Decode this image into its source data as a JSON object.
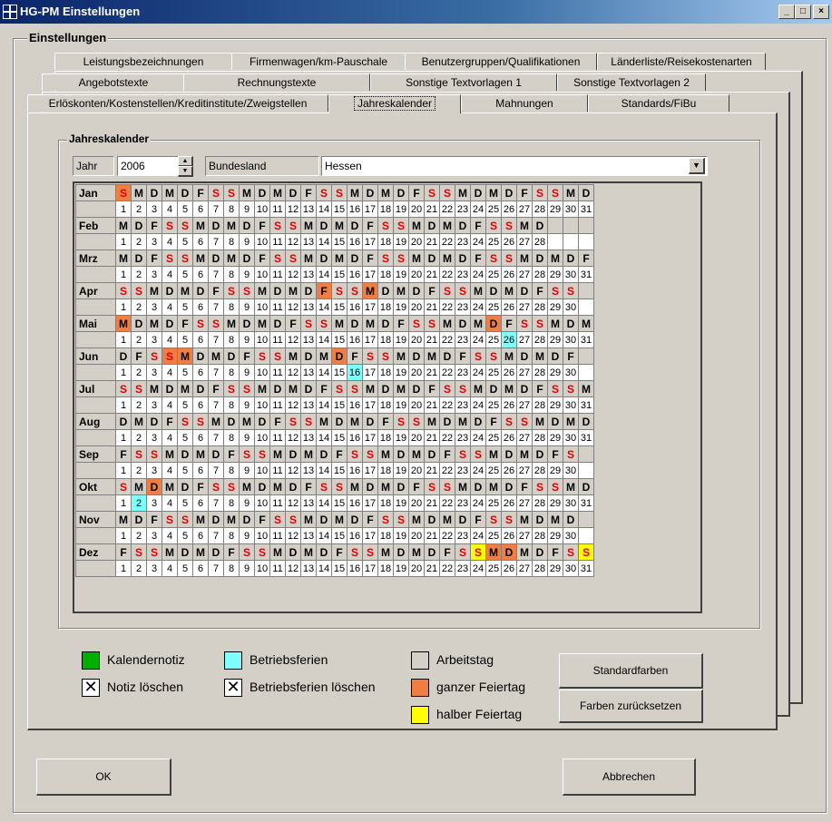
{
  "window": {
    "title": "HG-PM Einstellungen",
    "min": "_",
    "max": "□",
    "close": "×"
  },
  "outer_group": "Einstellungen",
  "tabs_row1": [
    "Leistungsbezeichnungen",
    "Firmenwagen/km-Pauschale",
    "Benutzergruppen/Qualifikationen",
    "Länderliste/Reisekostenarten"
  ],
  "tabs_row2": [
    "Angebotstexte",
    "Rechnungstexte",
    "Sonstige Textvorlagen 1",
    "Sonstige Textvorlagen 2"
  ],
  "tabs_row3": [
    "Erlöskonten/Kostenstellen/Kreditinstitute/Zweigstellen",
    "Jahreskalender",
    "Mahnungen",
    "Standards/FiBu"
  ],
  "cal_group": "Jahreskalender",
  "jahr_label": "Jahr",
  "jahr_value": "2006",
  "bundesland_label": "Bundesland",
  "bundesland_value": "Hessen",
  "months": [
    {
      "name": "Jan",
      "days": "SMDMDFSSMDMDFSSMDMDFSSMDMDFSSMD",
      "full": [
        1
      ],
      "half": [],
      "ferien": []
    },
    {
      "name": "Feb",
      "days": "MDFSSMDMDFSSMDMDFSSMDMDFSSMD",
      "full": [],
      "half": [],
      "ferien": []
    },
    {
      "name": "Mrz",
      "days": "MDFSSMDMDFSSMDMDFSSMDMDFSSMDMDF",
      "full": [],
      "half": [],
      "ferien": []
    },
    {
      "name": "Apr",
      "days": "SSMDMDFSSMDMDFSSMDMDFSSMDMDFSS",
      "full": [
        14,
        17
      ],
      "half": [],
      "ferien": []
    },
    {
      "name": "Mai",
      "days": "MDMDFSSMDMDFSSMDMDFSSMDMDFSSMDM",
      "full": [
        1,
        25
      ],
      "half": [],
      "ferien": [
        26
      ]
    },
    {
      "name": "Jun",
      "days": "DFSSMDMDFSSMDMDFSSMDMDFSSMDMDF",
      "full": [
        4,
        5,
        15
      ],
      "half": [],
      "ferien": [
        16
      ]
    },
    {
      "name": "Jul",
      "days": "SSMDMDFSSMDMDFSSMDMDFSSMDMDFSSM",
      "full": [],
      "half": [],
      "ferien": []
    },
    {
      "name": "Aug",
      "days": "DMDFSSMDMDFSSMDMDFSSMDMDFSSMDMD",
      "full": [],
      "half": [],
      "ferien": []
    },
    {
      "name": "Sep",
      "days": "FSSMDMDFSSMDMDFSSMDMDFSSMDMDFS",
      "full": [],
      "half": [],
      "ferien": []
    },
    {
      "name": "Okt",
      "days": "SMDMDFSSMDMDFSSMDMDFSSMDMDFSSMD",
      "full": [
        3
      ],
      "half": [],
      "ferien": [
        2
      ]
    },
    {
      "name": "Nov",
      "days": "MDFSSMDMDFSSMDMDFSSMDMDFSSMDMD",
      "full": [],
      "half": [],
      "ferien": []
    },
    {
      "name": "Dez",
      "days": "FSSMDMDFSSMDMDFSSMDMDFSSMDMDFSS",
      "full": [
        25,
        26
      ],
      "half": [
        24,
        31
      ],
      "ferien": []
    }
  ],
  "legend": {
    "kalendernotiz": "Kalendernotiz",
    "notiz_loeschen": "Notiz löschen",
    "betriebsferien": "Betriebsferien",
    "betriebsferien_loeschen": "Betriebsferien löschen",
    "arbeitstag": "Arbeitstag",
    "ganzer_feiertag": "ganzer Feiertag",
    "halber_feiertag": "halber Feiertag"
  },
  "buttons": {
    "standardfarben": "Standardfarben",
    "farben_zuruecksetzen": "Farben zurücksetzen",
    "ok": "OK",
    "abbrechen": "Abbrechen"
  },
  "colors": {
    "full": "#f07e43",
    "half": "#ffff00",
    "ferien": "#80ffff",
    "notiz": "#00b000",
    "weekend_text": "#e00000"
  }
}
